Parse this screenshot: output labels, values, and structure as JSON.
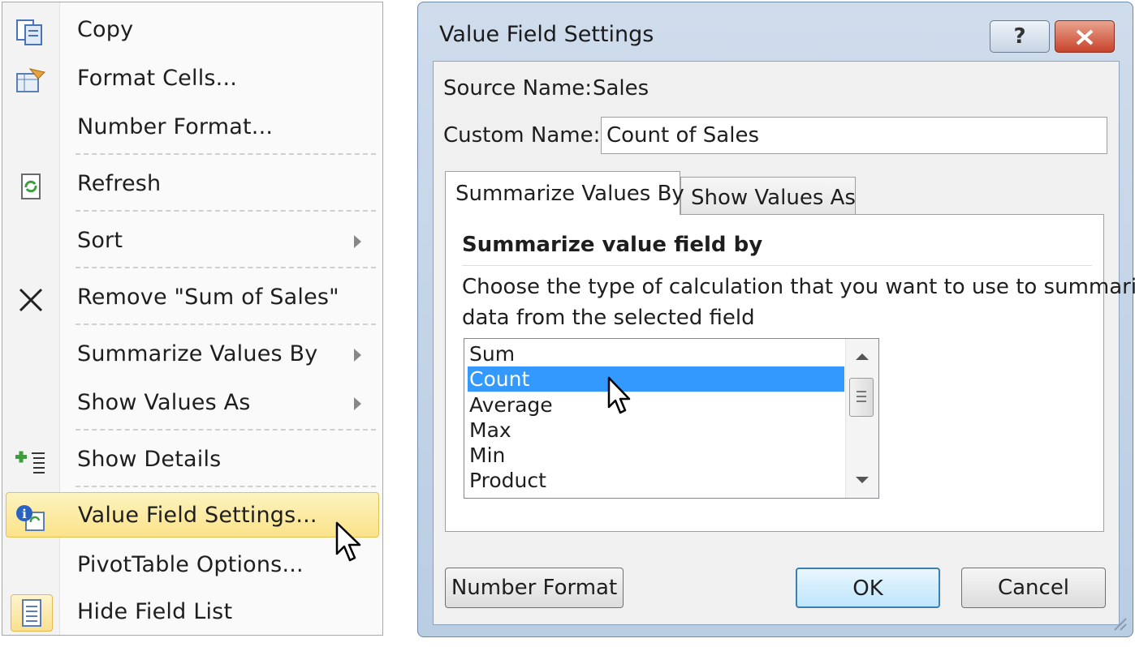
{
  "context_menu": {
    "items": [
      {
        "label": "Copy",
        "icon": "copy-icon"
      },
      {
        "label": "Format Cells...",
        "icon": "format-cells-icon"
      },
      {
        "label": "Number Format...",
        "icon": ""
      },
      {
        "label": "Refresh",
        "icon": "refresh-icon"
      },
      {
        "label": "Sort",
        "icon": "",
        "submenu": true
      },
      {
        "label": "Remove \"Sum of Sales\"",
        "icon": "remove-x-icon"
      },
      {
        "label": "Summarize Values By",
        "icon": "",
        "submenu": true
      },
      {
        "label": "Show Values As",
        "icon": "",
        "submenu": true
      },
      {
        "label": "Show Details",
        "icon": "show-details-icon"
      },
      {
        "label": "Value Field Settings...",
        "icon": "value-field-settings-icon",
        "highlighted": true
      },
      {
        "label": "PivotTable Options...",
        "icon": ""
      },
      {
        "label": "Hide Field List",
        "icon": "field-list-icon"
      }
    ]
  },
  "dialog": {
    "title": "Value Field Settings",
    "help_glyph": "?",
    "source_name_label": "Source Name:",
    "source_name_value": "Sales",
    "custom_name_label": "Custom Name:",
    "custom_name_value": "Count of Sales",
    "tabs": [
      {
        "label": "Summarize Values By",
        "active": true
      },
      {
        "label": "Show Values As",
        "active": false
      }
    ],
    "panel": {
      "heading": "Summarize value field by",
      "description_line1": "Choose the type of calculation that you want to use to summarize",
      "description_line2": "data from the selected field",
      "options": [
        "Sum",
        "Count",
        "Average",
        "Max",
        "Min",
        "Product"
      ],
      "selected": "Count"
    },
    "buttons": {
      "number_format": "Number Format",
      "ok": "OK",
      "cancel": "Cancel"
    }
  },
  "colors": {
    "highlight": "#fbe38a",
    "selection": "#3399ff",
    "dialog_frame": "#c4d5e8",
    "close_button": "#c8432b"
  }
}
